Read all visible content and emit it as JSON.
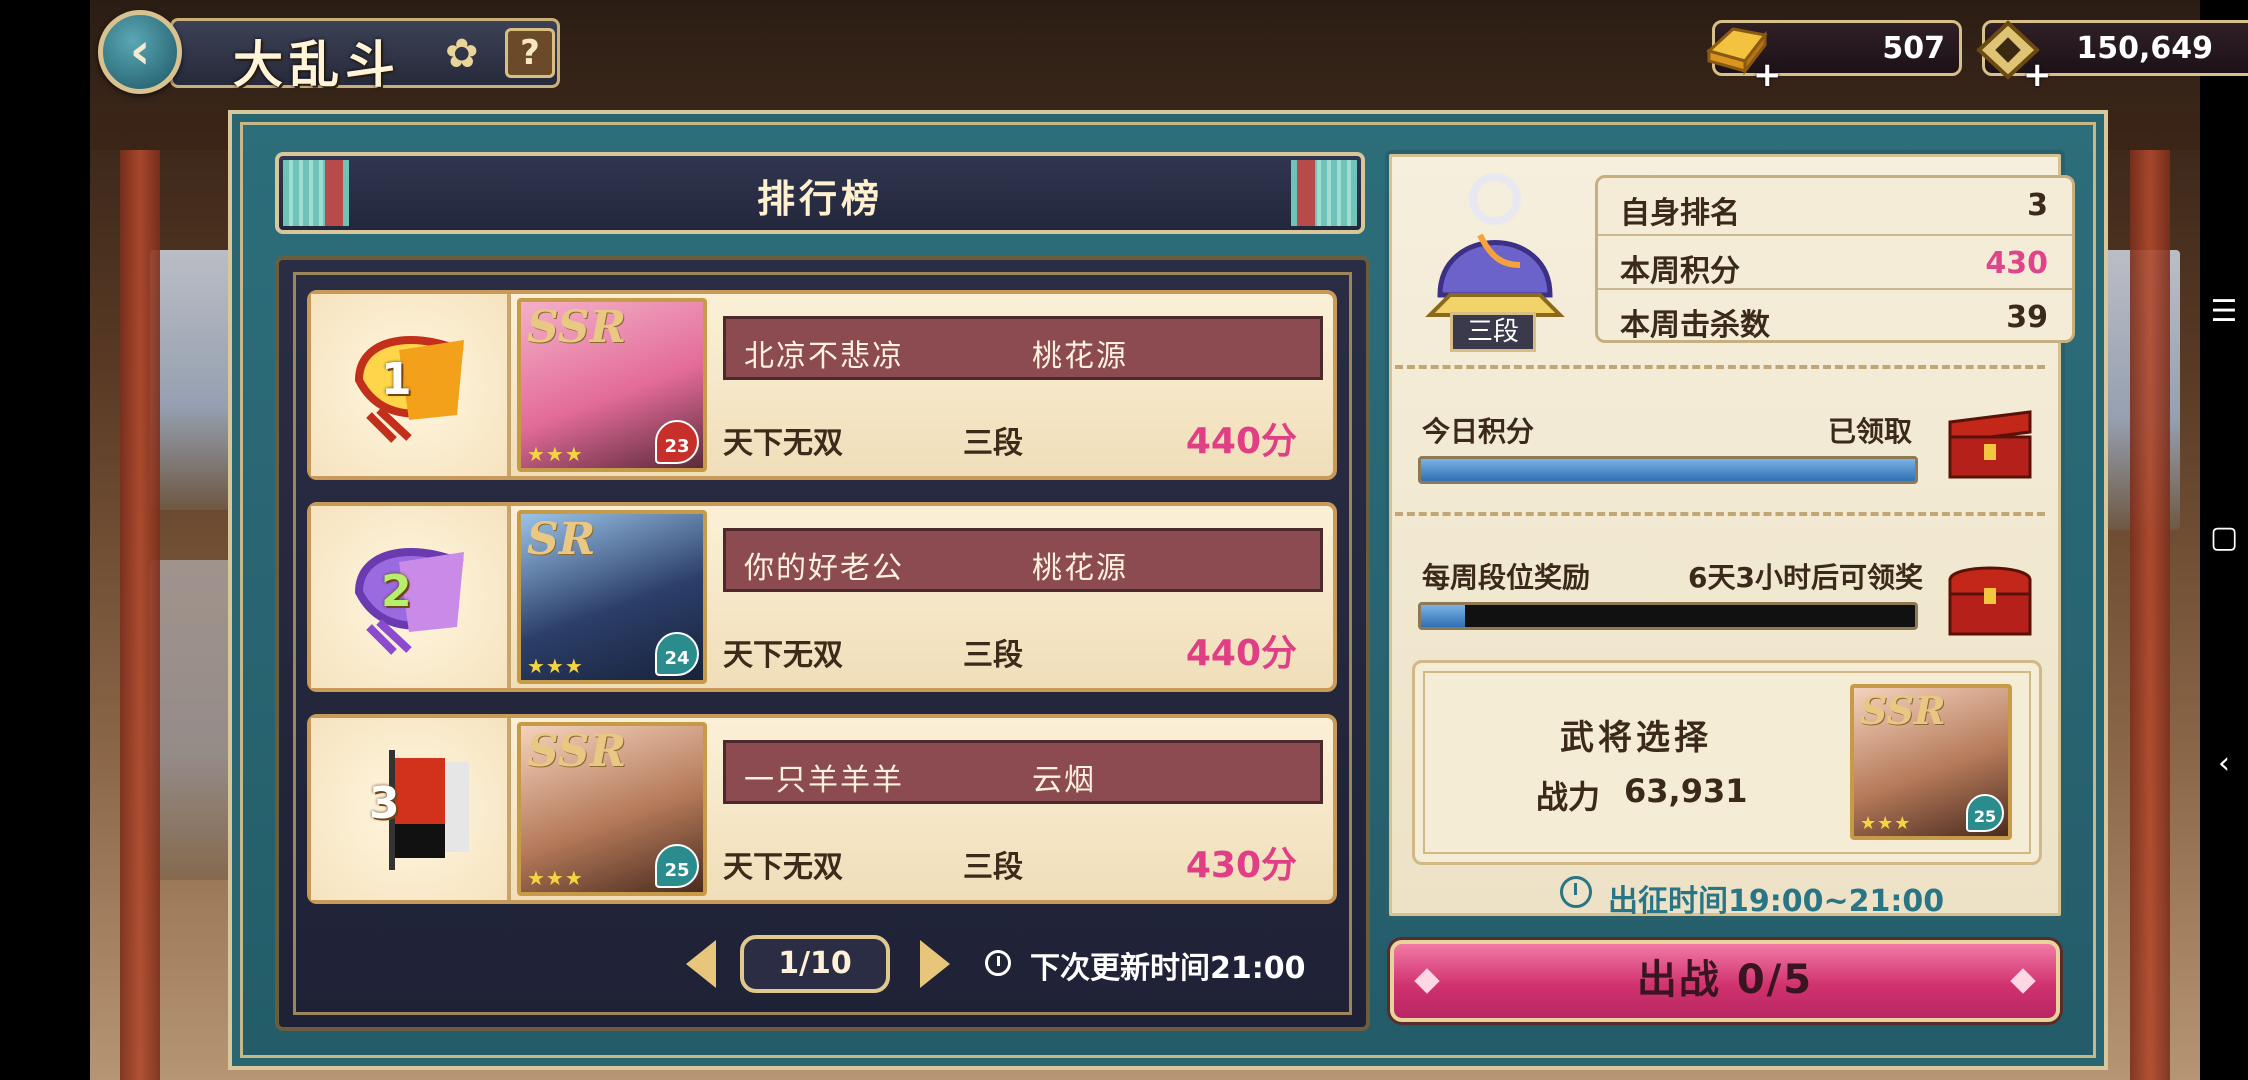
{
  "header": {
    "title": "大乱斗",
    "back_icon": "chevron-left-icon",
    "help_label": "?"
  },
  "currencies": [
    {
      "name": "gold",
      "value": "507",
      "icon": "gold-ingot-icon"
    },
    {
      "name": "coins",
      "value": "150,649",
      "icon": "coin-icon"
    }
  ],
  "leaderboard": {
    "title": "排行榜",
    "rows": [
      {
        "rank": "1",
        "rarity": "SSR",
        "stars": "★★★",
        "level": "23",
        "level_color": "#c62f2a",
        "player": "北凉不悲凉",
        "guild": "桃花源",
        "title": "天下无双",
        "tier": "三段",
        "score": "440分"
      },
      {
        "rank": "2",
        "rarity": "SR",
        "stars": "★★★",
        "level": "24",
        "level_color": "#2a8c8c",
        "player": "你的好老公",
        "guild": "桃花源",
        "title": "天下无双",
        "tier": "三段",
        "score": "440分"
      },
      {
        "rank": "3",
        "rarity": "SSR",
        "stars": "★★★",
        "level": "25",
        "level_color": "#2a8c8c",
        "player": "一只羊羊羊",
        "guild": "云烟",
        "title": "天下无双",
        "tier": "三段",
        "score": "430分"
      }
    ],
    "page": "1/10",
    "refresh_text": "下次更新时间21:00"
  },
  "self_info": {
    "tier_badge": "三段",
    "stats": [
      {
        "label": "自身排名",
        "value": "3",
        "highlight": false
      },
      {
        "label": "本周积分",
        "value": "430",
        "highlight": true
      },
      {
        "label": "本周击杀数",
        "value": "39",
        "highlight": false
      }
    ],
    "daily": {
      "label": "今日积分",
      "status": "已领取",
      "progress": 1.0
    },
    "weekly": {
      "label": "每周段位奖励",
      "status": "6天3小时后可领奖",
      "progress": 0.09
    },
    "general": {
      "title": "武将选择",
      "power_label": "战力",
      "power": "63,931",
      "rarity": "SSR",
      "level": "25",
      "stars": "★★★"
    },
    "march_time": "出征时间19:00~21:00",
    "battle_button": "出战 0/5"
  },
  "colors": {
    "accent_pink": "#e03f86",
    "teal": "#2a7585",
    "panel": "#2d6e7b"
  }
}
